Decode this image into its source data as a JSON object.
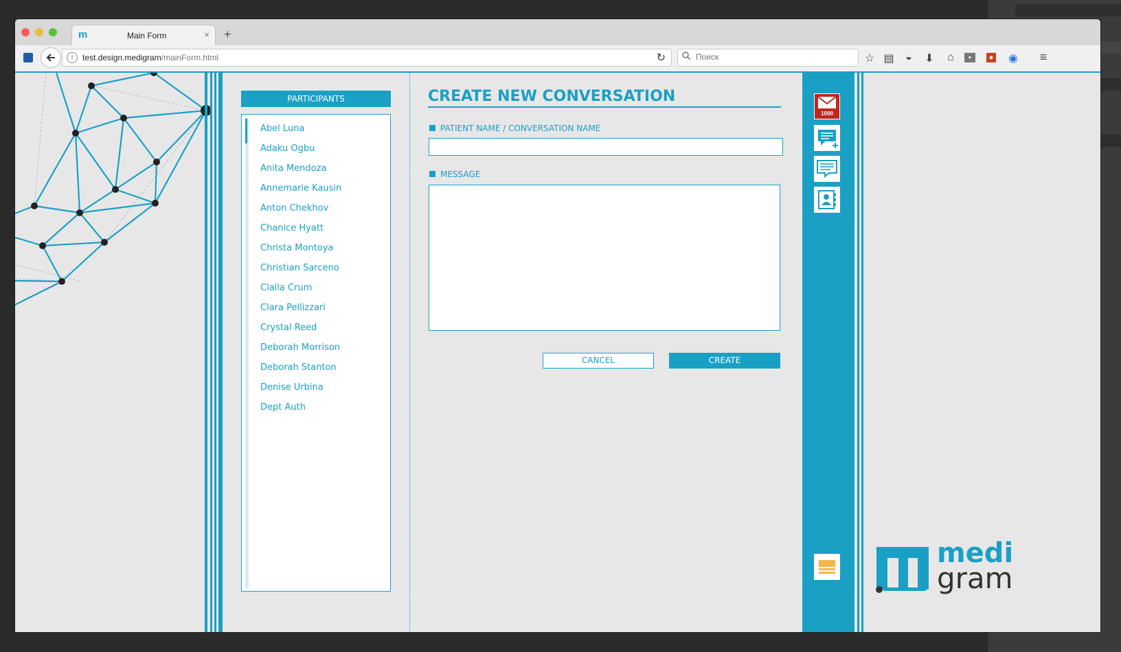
{
  "browser": {
    "tab_title": "Main Form",
    "tab_close": "×",
    "new_tab": "+",
    "url_host": "test.design.medigram",
    "url_path": "/mainForm.html",
    "search_placeholder": "Поиск"
  },
  "participants": {
    "header": "PARTICIPANTS",
    "items": [
      "Abel Luna",
      "Adaku Ogbu",
      "Anita Mendoza",
      "Annemarie Kausin",
      "Anton Chekhov",
      "Chanice Hyatt",
      "Christa Montoya",
      "Christian Sarceno",
      "Clalla Crum",
      "Clara Pellizzari",
      "Crystal Reed",
      "Deborah Morrison",
      "Deborah Stanton",
      "Denise Urbina",
      "Dept Auth"
    ]
  },
  "form": {
    "title": "CREATE NEW CONVERSATION",
    "name_label": "PATIENT NAME / CONVERSATION NAME",
    "name_value": "",
    "message_label": "MESSAGE",
    "message_value": "",
    "cancel_label": "CANCEL",
    "create_label": "CREATE"
  },
  "side_panel": {
    "mail_count": "1000"
  },
  "logo": {
    "line1": "medi",
    "line2": "gram"
  },
  "colors": {
    "accent": "#1aa0c4",
    "mail": "#c0281f",
    "menu_orange": "#f3b64b",
    "background": "#e7e7e8"
  },
  "icons": [
    "close-icon",
    "back-arrow-icon",
    "info-icon",
    "reload-icon",
    "search-icon",
    "star-icon",
    "reading-list-icon",
    "pocket-icon",
    "download-icon",
    "home-icon",
    "extension-icon",
    "hamburger-menu-icon",
    "mail-icon",
    "new-message-icon",
    "conversations-icon",
    "contacts-icon",
    "menu-icon"
  ]
}
